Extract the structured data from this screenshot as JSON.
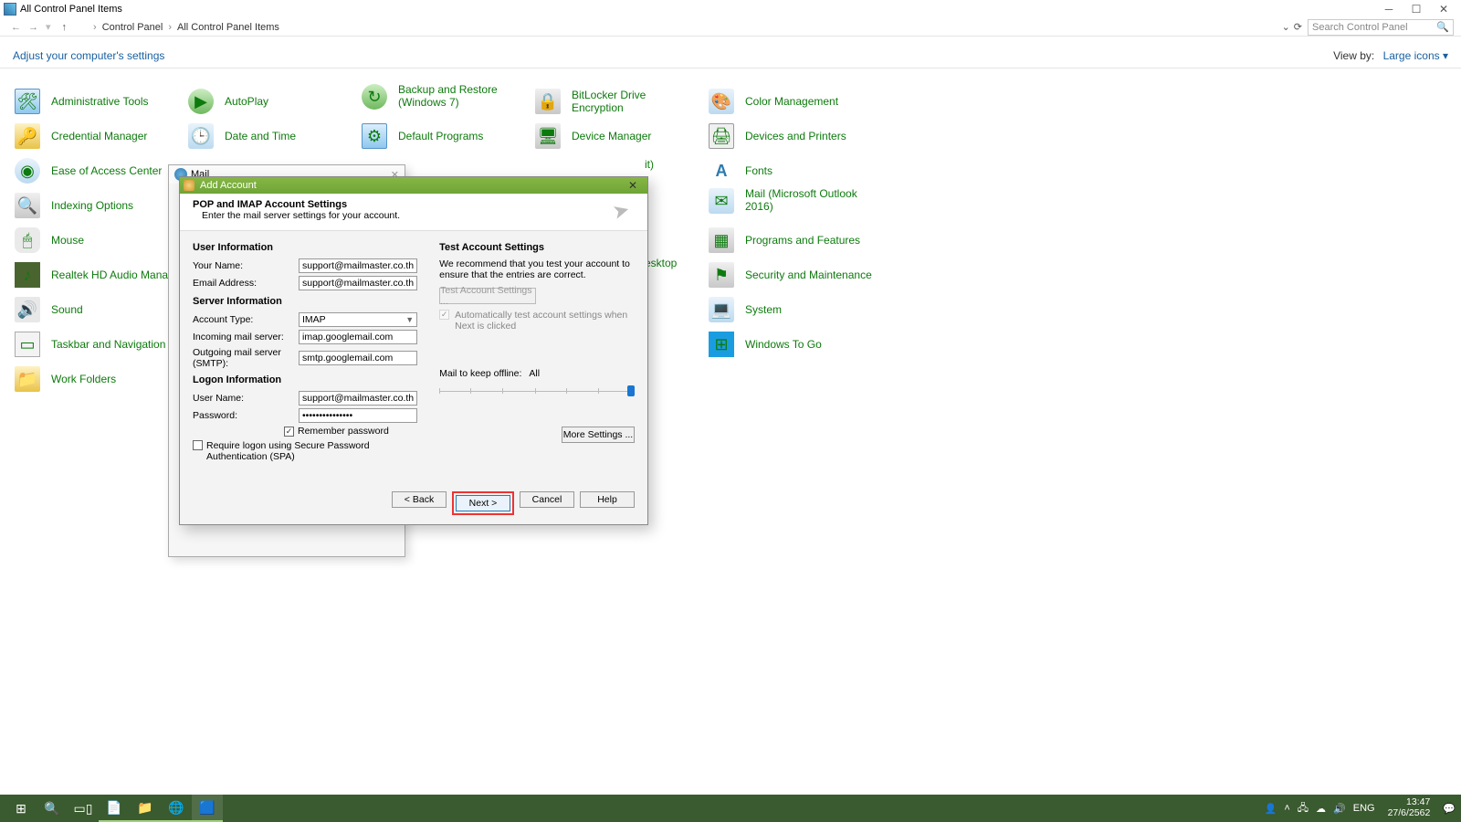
{
  "window": {
    "title": "All Control Panel Items",
    "breadcrumb": [
      "Control Panel",
      "All Control Panel Items"
    ],
    "search_placeholder": "Search Control Panel",
    "adjust_label": "Adjust your computer's settings",
    "view_by_label": "View by:",
    "view_by_value": "Large icons"
  },
  "cp_items": {
    "c1r1": "Administrative Tools",
    "c2r1": "AutoPlay",
    "c3r1": "Backup and Restore (Windows 7)",
    "c4r1": "BitLocker Drive Encryption",
    "c5r1": "Color Management",
    "c1r2": "Credential Manager",
    "c2r2": "Date and Time",
    "c3r2": "Default Programs",
    "c4r2": "Device Manager",
    "c5r2": "Devices and Printers",
    "c1r3": "Ease of Access Center",
    "c4r3_partial": "it)",
    "c5r3": "Fonts",
    "c1r4": "Indexing Options",
    "c5r4": "Mail (Microsoft Outlook 2016)",
    "c1r5": "Mouse",
    "c5r5": "Programs and Features",
    "c1r6": "Realtek HD Audio Manager",
    "c4r6_partial": "esktop",
    "c5r6": "Security and Maintenance",
    "c1r7": "Sound",
    "c5r7": "System",
    "c1r8": "Taskbar and Navigation",
    "c5r8": "Windows To Go",
    "c1r9": "Work Folders"
  },
  "mail_peek": {
    "title": "Mail"
  },
  "dialog": {
    "title": "Add Account",
    "header_line1": "POP and IMAP Account Settings",
    "header_line2": "Enter the mail server settings for your account.",
    "sections": {
      "user": "User Information",
      "server": "Server Information",
      "logon": "Logon Information",
      "test": "Test Account Settings"
    },
    "labels": {
      "your_name": "Your Name:",
      "email": "Email Address:",
      "acct_type": "Account Type:",
      "incoming": "Incoming mail server:",
      "outgoing": "Outgoing mail server (SMTP):",
      "username": "User Name:",
      "password": "Password:",
      "remember": "Remember password",
      "spa": "Require logon using Secure Password Authentication (SPA)",
      "test_desc": "We recommend that you test your account to ensure that the entries are correct.",
      "test_btn": "Test Account Settings ...",
      "auto_test": "Automatically test account settings when Next is clicked",
      "mail_offline": "Mail to keep offline:",
      "mail_offline_val": "All",
      "more": "More Settings ..."
    },
    "values": {
      "your_name": "support@mailmaster.co.th",
      "email": "support@mailmaster.co.th",
      "acct_type": "IMAP",
      "incoming": "imap.googlemail.com",
      "outgoing": "smtp.googlemail.com",
      "username": "support@mailmaster.co.th",
      "password": "•••••••••••••••"
    },
    "buttons": {
      "back": "< Back",
      "next": "Next >",
      "cancel": "Cancel",
      "help": "Help"
    }
  },
  "taskbar": {
    "lang": "ENG",
    "time": "13:47",
    "date": "27/6/2562"
  }
}
